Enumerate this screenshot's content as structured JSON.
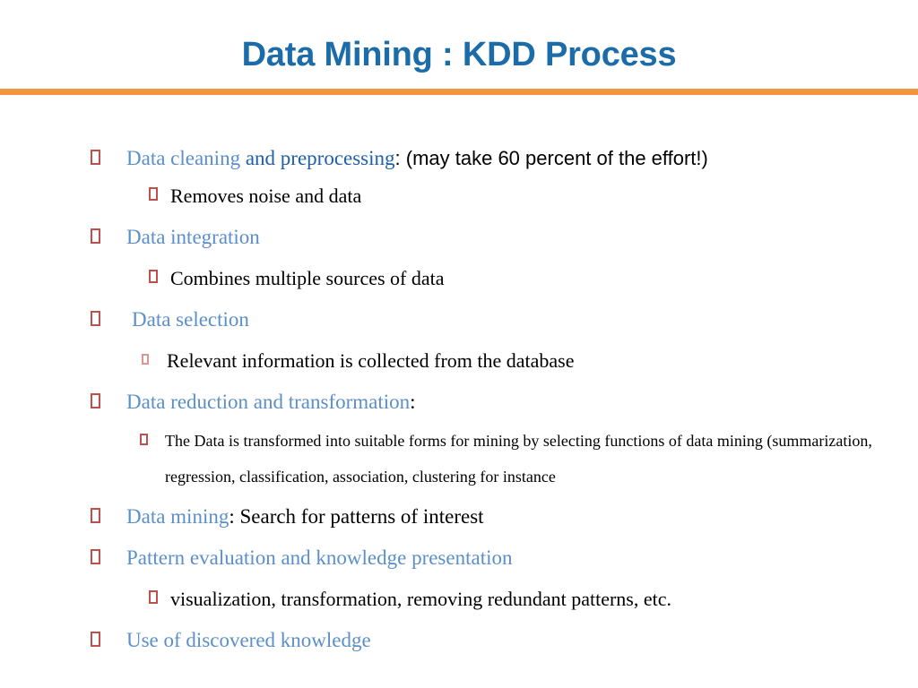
{
  "slide": {
    "title": "Data Mining : KDD Process",
    "accent_color": "#F0943E",
    "title_color": "#1B6CA8",
    "bullet_color": "#C0504D",
    "body_blue": "#4A7EBB"
  },
  "bullets": {
    "cleaning": {
      "part_a": "Data cleaning ",
      "part_b": "and preprocessing",
      "part_c": ": (may take 60 percent of the effort!)"
    },
    "removes": {
      "text": "Removes noise and data"
    },
    "integration": {
      "text": "Data integration"
    },
    "combines": {
      "text": "Combines multiple sources of data"
    },
    "selection": {
      "text": "Data selection"
    },
    "relevant": {
      "text": " Relevant information is collected from the database"
    },
    "reduction": {
      "part_a": "Data reduction and transformation",
      "part_b": ":"
    },
    "thedata": {
      "text": "The Data is  transformed into suitable forms for mining by selecting functions of data mining (summarization, regression, classification, association, clustering for instance"
    },
    "mining": {
      "part_a": "Data mining",
      "part_b": ": Search for patterns of interest"
    },
    "pattern": {
      "text": "Pattern evaluation and knowledge presentation"
    },
    "visualization": {
      "text": "visualization, transformation, removing redundant patterns, etc."
    },
    "use": {
      "text": "Use of discovered knowledge"
    }
  }
}
